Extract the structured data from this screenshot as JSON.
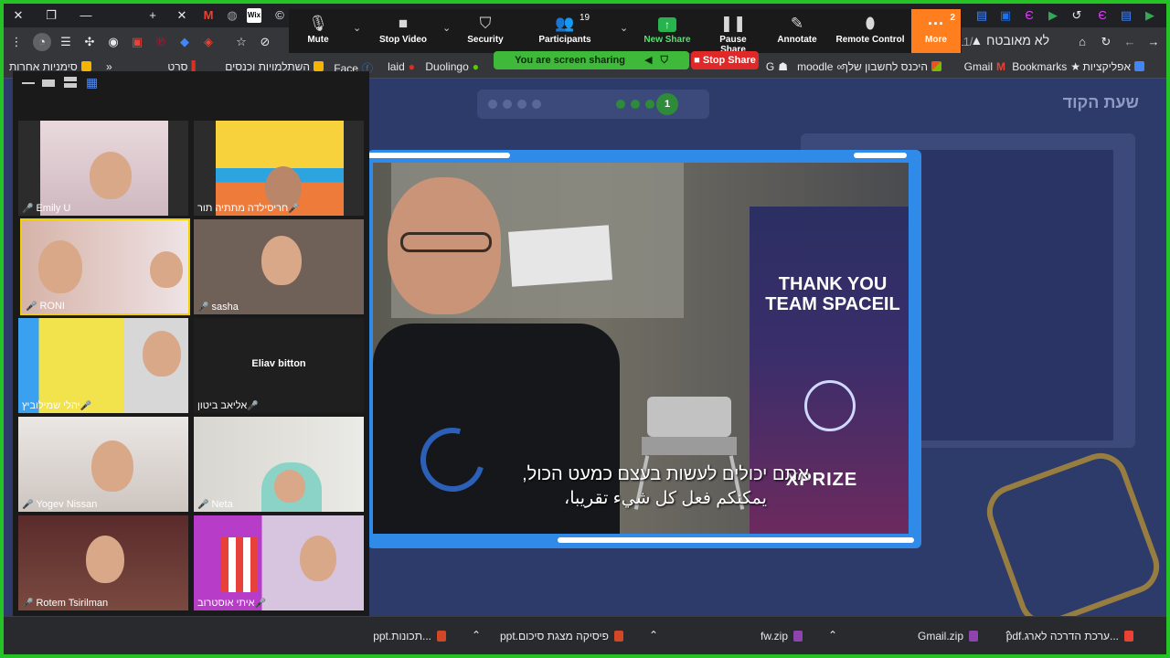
{
  "browser": {
    "tabs_new": "+",
    "address_text": "לא מאובטח",
    "url_fragment": "11/",
    "bookmarks": [
      {
        "label": "אפליקציות",
        "color": "#4285f4"
      },
      {
        "label": "Bookmarks",
        "color": "#ffffff"
      },
      {
        "label": "Gmail",
        "color": "#ea4335"
      },
      {
        "label": "היכנס לחשבון שלך",
        "color": "#f4b400"
      },
      {
        "label": "moodle",
        "color": "#f98012"
      },
      {
        "label": "G",
        "color": "#4285f4"
      },
      {
        "label": "Duolingo",
        "color": "#58cc02"
      },
      {
        "label": "laid",
        "color": "#d93025"
      },
      {
        "label": "Face",
        "color": "#1877f2"
      },
      {
        "label": "השתלמויות וכנסים",
        "color": "#f4b400"
      },
      {
        "label": "סרט",
        "color": "#d93025"
      },
      {
        "label": "סימניות אחרות",
        "color": "#f4b400"
      }
    ],
    "bookmarks_overflow": "»"
  },
  "zoom": {
    "controls": [
      {
        "icon": "microphone-icon",
        "label": "Mute",
        "glyph": "🎙"
      },
      {
        "icon": "video-camera-icon",
        "label": "Stop Video",
        "glyph": "📹"
      },
      {
        "icon": "shield-icon",
        "label": "Security",
        "glyph": "🛡"
      },
      {
        "icon": "participants-icon",
        "label": "Participants",
        "glyph": "👥"
      },
      {
        "icon": "share-arrow-icon",
        "label": "New Share",
        "glyph": "↑"
      },
      {
        "icon": "pause-icon",
        "label": "Pause Share",
        "glyph": "❚❚"
      },
      {
        "icon": "pencil-icon",
        "label": "Annotate",
        "glyph": "✎"
      },
      {
        "icon": "mouse-icon",
        "label": "Remote Control",
        "glyph": "🖱"
      }
    ],
    "participants_count": "19",
    "more_label": "More",
    "more_badge": "2",
    "sharing_status": "You are screen sharing",
    "stop_share_label": "Stop Share"
  },
  "gallery": {
    "participants": [
      {
        "name": "Emily U"
      },
      {
        "name": "חריסילדה מתתיה תור"
      },
      {
        "name": "RONI"
      },
      {
        "name": "sasha"
      },
      {
        "name": "יהלי שמילוביץ"
      },
      {
        "name": "אליאב ביטון",
        "display": "Eliav bitton"
      },
      {
        "name": "Yogev Nissan"
      },
      {
        "name": "Neta"
      },
      {
        "name": "Rotem Tsirilman"
      },
      {
        "name": "איתי אוסטרוב"
      }
    ]
  },
  "page": {
    "title": "שעת הקוד",
    "progress_step": "1"
  },
  "video": {
    "poster_title": "THANK YOU TEAM SPACEIL",
    "poster_brand": "XPRIZE",
    "subtitle_hebrew": "אתם יכולים לעשות בעצם כמעט הכול,",
    "subtitle_arabic": "يمكنكم فعل كل شيء تقريبا،"
  },
  "downloads": [
    {
      "name": "...ערכת הדרכה לארג.pdf",
      "color": "#ea4335"
    },
    {
      "name": "Gmail.zip",
      "color": "#8e44ad"
    },
    {
      "name": "fw.zip",
      "color": "#8e44ad"
    },
    {
      "name": "פיסיקה מצגת סיכום.ppt",
      "color": "#d24726"
    },
    {
      "name": "...תכונות.ppt",
      "color": "#d24726"
    }
  ]
}
